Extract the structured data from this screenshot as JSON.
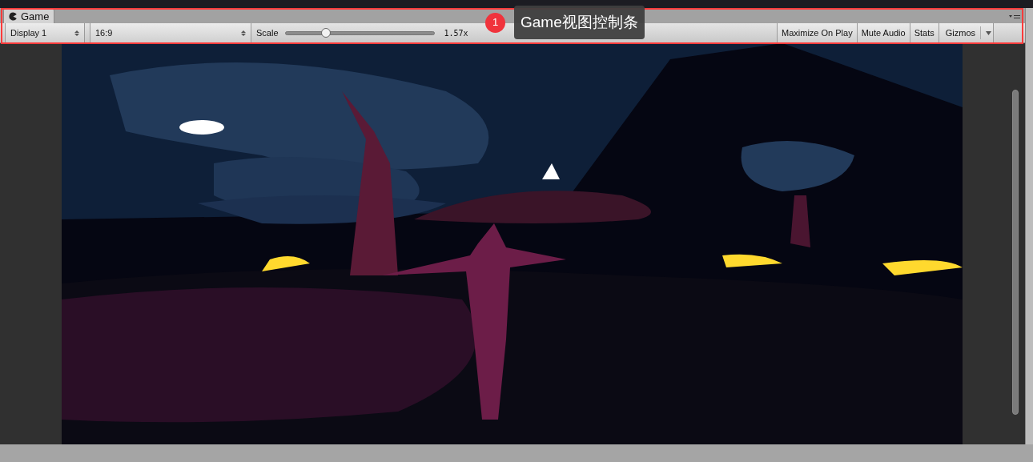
{
  "tab": {
    "label": "Game",
    "selected": true
  },
  "toolbar": {
    "display": "Display 1",
    "aspect": "16:9",
    "scale": {
      "label": "Scale",
      "level": 0.26,
      "reading": "1.57x"
    },
    "toggles": [
      {
        "label": "Maximize On Play",
        "on": false
      },
      {
        "label": "Mute Audio",
        "on": false
      },
      {
        "label": "Stats",
        "on": false
      }
    ],
    "gizmos": {
      "label": "Gizmos",
      "on": false
    }
  },
  "callout": {
    "number": "1",
    "text": "Game视图控制条"
  }
}
